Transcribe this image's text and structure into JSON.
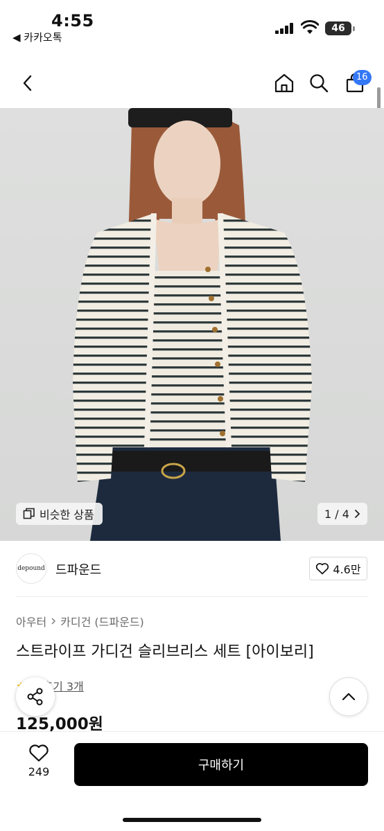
{
  "status_bar": {
    "time": "4:55",
    "back_app": "◀ 카카오톡",
    "battery": "46"
  },
  "nav": {
    "back_icon": "chevron-left-icon",
    "home_icon": "home-icon",
    "search_icon": "search-icon",
    "cart_icon": "shopping-bag-icon",
    "cart_count": "16"
  },
  "gallery": {
    "similar_label": "비슷한 상품",
    "page_indicator": "1 / 4"
  },
  "brand": {
    "logo_text": "depound",
    "name": "드파운드",
    "likes": "4.6만"
  },
  "product": {
    "breadcrumb": [
      "아우터",
      "카디건 (드파운드)"
    ],
    "title": "스트라이프 가디건 슬리브리스 세트 [아이보리]",
    "review_label": "후기 3개",
    "price": "125,000원"
  },
  "bottom": {
    "wish_count": "249",
    "buy_label": "구매하기"
  },
  "colors": {
    "accent_blue": "#3478f6",
    "buy_button": "#000000",
    "star": "#f5b800"
  }
}
